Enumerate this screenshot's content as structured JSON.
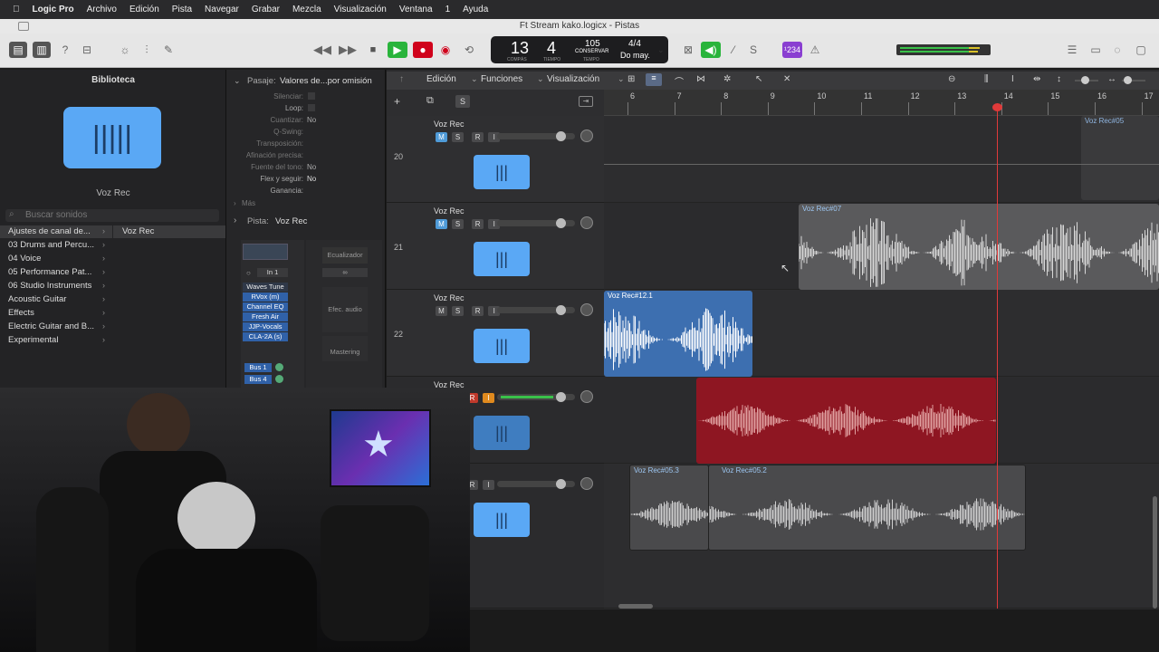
{
  "menubar": {
    "apple": "",
    "app": "Logic Pro",
    "items": [
      "Archivo",
      "Edición",
      "Pista",
      "Navegar",
      "Grabar",
      "Mezcla",
      "Visualización",
      "Ventana",
      "1",
      "Ayuda"
    ]
  },
  "window_title": "Ft Stream kako.logicx - Pistas",
  "lcd": {
    "bars": "13",
    "beats": "4",
    "compas_label": "COMPÁS",
    "tiempo_label": "TIEMPO",
    "tempo": "105",
    "tempo_sub": "CONSERVAR",
    "tempo_label": "TEMPO",
    "signature": "4/4",
    "key": "Do may."
  },
  "toolbar": {
    "count_in": "¹234"
  },
  "library": {
    "title": "Biblioteca",
    "preset_name": "Voz Rec",
    "search_placeholder": "Buscar sonidos",
    "categories": [
      "Ajustes de canal de...",
      "03 Drums and Percu...",
      "04 Voice",
      "05 Performance Pat...",
      "06 Studio Instruments",
      "Acoustic Guitar",
      "Effects",
      "Electric Guitar and B...",
      "Experimental"
    ],
    "selected_item": "Voz Rec"
  },
  "inspector": {
    "region_header": "Pasaje:",
    "region_value": "Valores de...por omisión",
    "params": [
      {
        "label": "Silenciar:",
        "value": ""
      },
      {
        "label": "Loop:",
        "value": ""
      },
      {
        "label": "Cuantizar:",
        "value": "No"
      },
      {
        "label": "Q-Swing:",
        "value": ""
      },
      {
        "label": "Transposición:",
        "value": ""
      },
      {
        "label": "Afinación precisa:",
        "value": ""
      },
      {
        "label": "Fuente del tono:",
        "value": "No"
      },
      {
        "label": "Flex y seguir:",
        "value": "No"
      },
      {
        "label": "Ganancia:",
        "value": ""
      }
    ],
    "more": "Más",
    "track_header": "Pista:",
    "track_value": "Voz Rec",
    "eq_label": "Ecualizador",
    "input": "In 1",
    "fx_label": "Efec. audio",
    "plugins": [
      "Waves Tune",
      "RVox (m)",
      "Channel EQ",
      "Fresh Air",
      "JJP-Vocals",
      "CLA-2A (s)"
    ],
    "mastering": "Mastering",
    "sends": [
      "Bus 1",
      "Bus 4"
    ]
  },
  "local_menus": {
    "edit": "Edición",
    "functions": "Funciones",
    "view": "Visualización"
  },
  "ruler": {
    "bars": [
      "6",
      "7",
      "8",
      "9",
      "10",
      "11",
      "12",
      "13",
      "14",
      "15",
      "16",
      "17"
    ]
  },
  "tracks": [
    {
      "number": "20",
      "name": "Voz Rec",
      "mute_on": true
    },
    {
      "number": "21",
      "name": "Voz Rec",
      "mute_on": true
    },
    {
      "number": "22",
      "name": "Voz Rec",
      "mute_on": false
    },
    {
      "number": "",
      "name": "Voz Rec",
      "mute_on": false
    },
    {
      "number": "",
      "name": "",
      "mute_on": false
    }
  ],
  "track_buttons": {
    "m": "M",
    "s": "S",
    "r": "R",
    "i": "I"
  },
  "regions": [
    {
      "name": "Voz Rec#05",
      "color": "#4a4a4c"
    },
    {
      "name": "Voz Rec#07",
      "color": "#5a5a5c"
    },
    {
      "name": "Voz Rec#12.1",
      "color": "#3d6fb0"
    },
    {
      "name": "",
      "color": "#8e1622"
    },
    {
      "name": "Voz Rec#05.3",
      "color": "#4a4a4c"
    },
    {
      "name": "Voz Rec#05.2",
      "color": "#4a4a4c"
    }
  ],
  "colors": {
    "accent": "#5aa8f5",
    "record": "#d0021b",
    "play": "#29b43b"
  }
}
